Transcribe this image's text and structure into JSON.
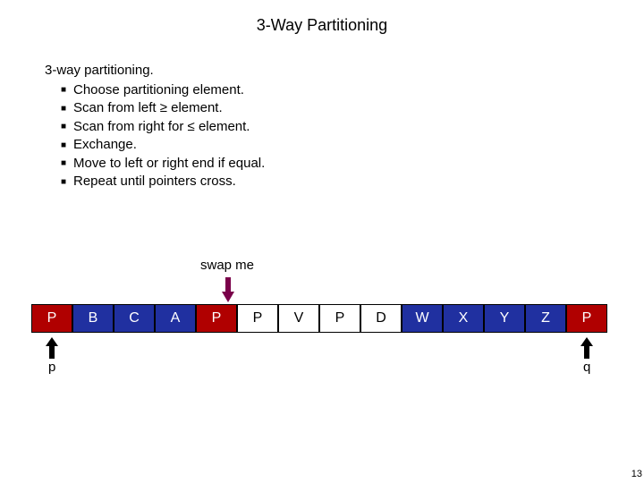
{
  "title": "3-Way Partitioning",
  "heading": "3-way partitioning.",
  "bullets": [
    "Choose partitioning element.",
    "Scan from left ≥ element.",
    "Scan from right for ≤  element.",
    "Exchange.",
    "Move to left or right end if equal.",
    "Repeat until pointers cross."
  ],
  "swap_label": "swap me",
  "cells": [
    "P",
    "B",
    "C",
    "A",
    "P",
    "P",
    "V",
    "P",
    "D",
    "W",
    "X",
    "Y",
    "Z",
    "P"
  ],
  "colors": [
    "red",
    "blue",
    "blue",
    "blue",
    "red",
    "white",
    "white",
    "white",
    "white",
    "blue",
    "blue",
    "blue",
    "blue",
    "red"
  ],
  "p_label": "p",
  "q_label": "q",
  "page_number": "13"
}
